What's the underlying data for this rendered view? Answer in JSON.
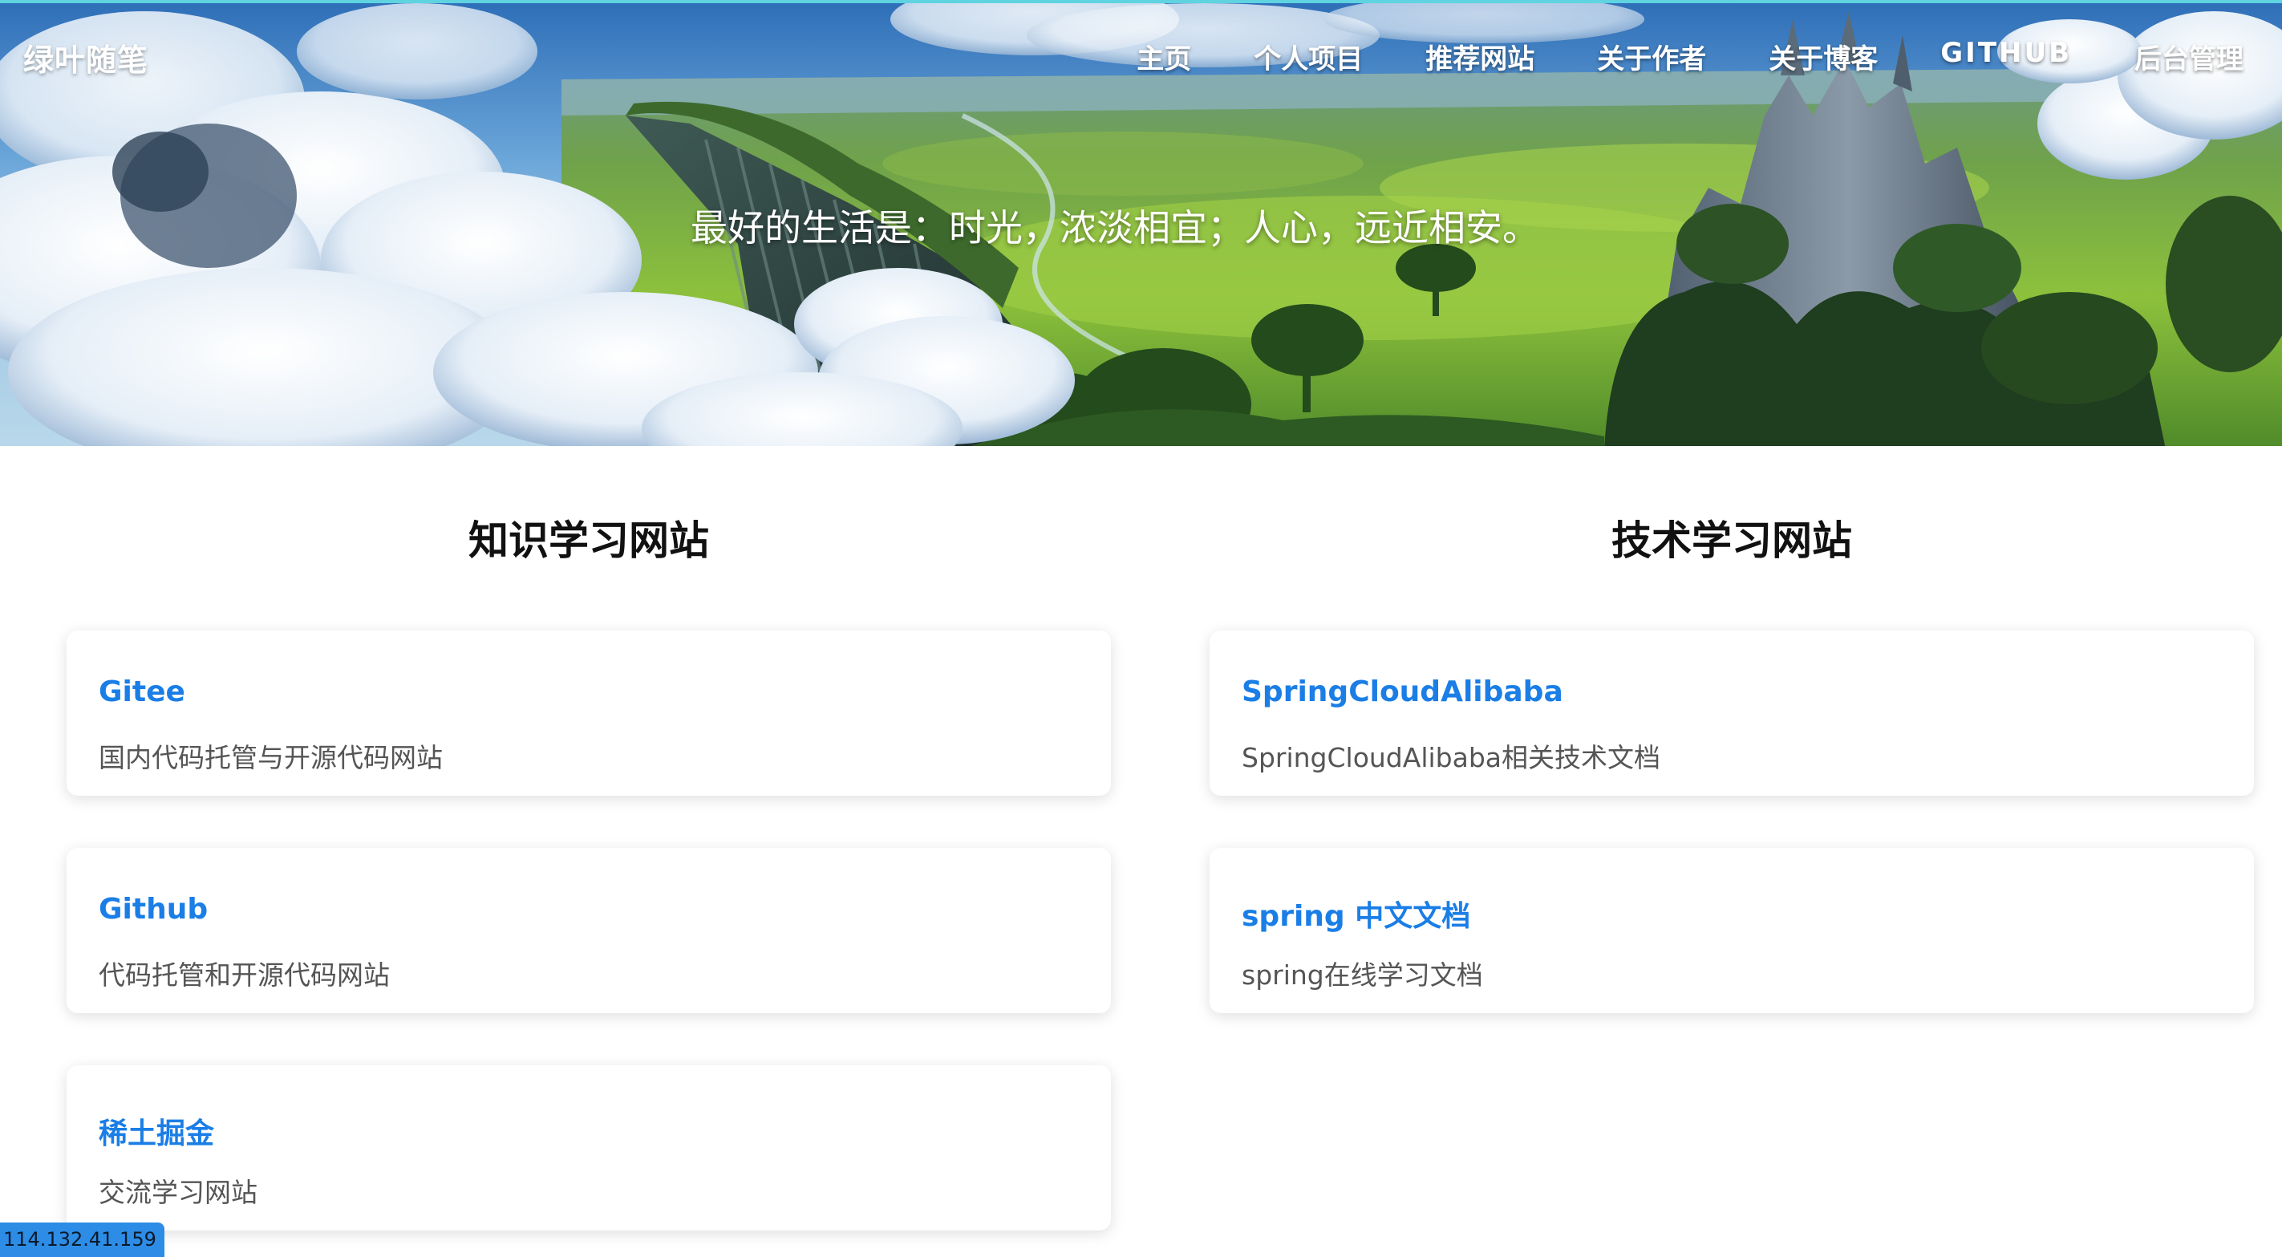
{
  "brand": "绿叶随笔",
  "nav": [
    {
      "label": "主页"
    },
    {
      "label": "个人项目"
    },
    {
      "label": "推荐网站"
    },
    {
      "label": "关于作者"
    },
    {
      "label": "关于博客"
    },
    {
      "label": "GITHUB"
    },
    {
      "label": "后台管理"
    }
  ],
  "motto": "最好的生活是：时光，浓淡相宜；人心，远近相安。",
  "sections": [
    {
      "title": "知识学习网站",
      "cards": [
        {
          "title": "Gitee",
          "desc": "国内代码托管与开源代码网站"
        },
        {
          "title": "Github",
          "desc": "代码托管和开源代码网站"
        },
        {
          "title": "稀土掘金",
          "desc": "交流学习网站"
        }
      ]
    },
    {
      "title": "技术学习网站",
      "cards": [
        {
          "title": "SpringCloudAlibaba",
          "desc": "SpringCloudAlibaba相关技术文档"
        },
        {
          "title": "spring 中文文档",
          "desc": "spring在线学习文档"
        }
      ]
    }
  ],
  "status_ip": "114.132.41.159",
  "colors": {
    "link": "#1a7ee6",
    "accent_top": "#5fd3e0",
    "ip_tag": "#2d8ce6"
  }
}
